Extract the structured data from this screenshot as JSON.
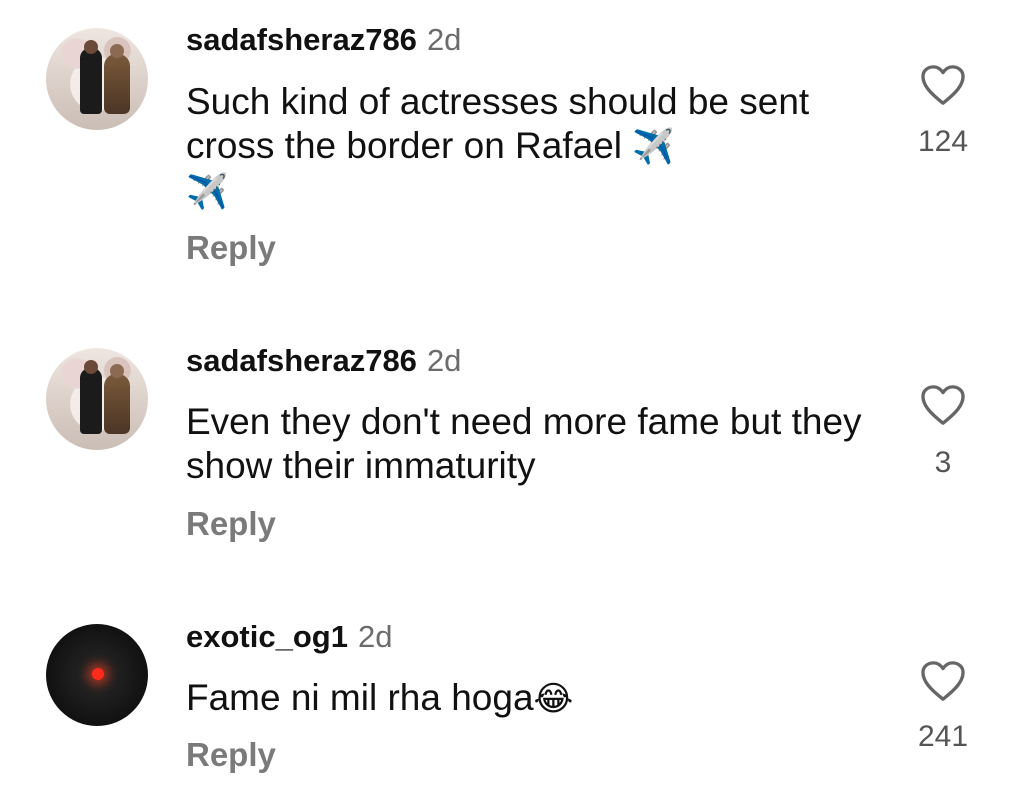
{
  "comments": [
    {
      "username": "sadafsheraz786",
      "time": "2d",
      "text": "Such kind of actresses should be sent cross the border on Rafael",
      "emoji": "✈️",
      "emoji2": "✈️",
      "reply_label": "Reply",
      "like_count": "124",
      "avatar": "couple-photo"
    },
    {
      "username": "sadafsheraz786",
      "time": "2d",
      "text": "Even they don't need more fame but they show their immaturity",
      "reply_label": "Reply",
      "like_count": "3",
      "avatar": "couple-photo"
    },
    {
      "username": "exotic_og1",
      "time": "2d",
      "text": "Fame ni mil rha hoga",
      "emoji": "😂",
      "reply_label": "Reply",
      "like_count": "241",
      "avatar": "red-dot-dark"
    }
  ],
  "icons": {
    "like": "heart-outline-icon"
  },
  "colors": {
    "username": "#111111",
    "muted": "#7a7a7a",
    "count": "#555555"
  }
}
